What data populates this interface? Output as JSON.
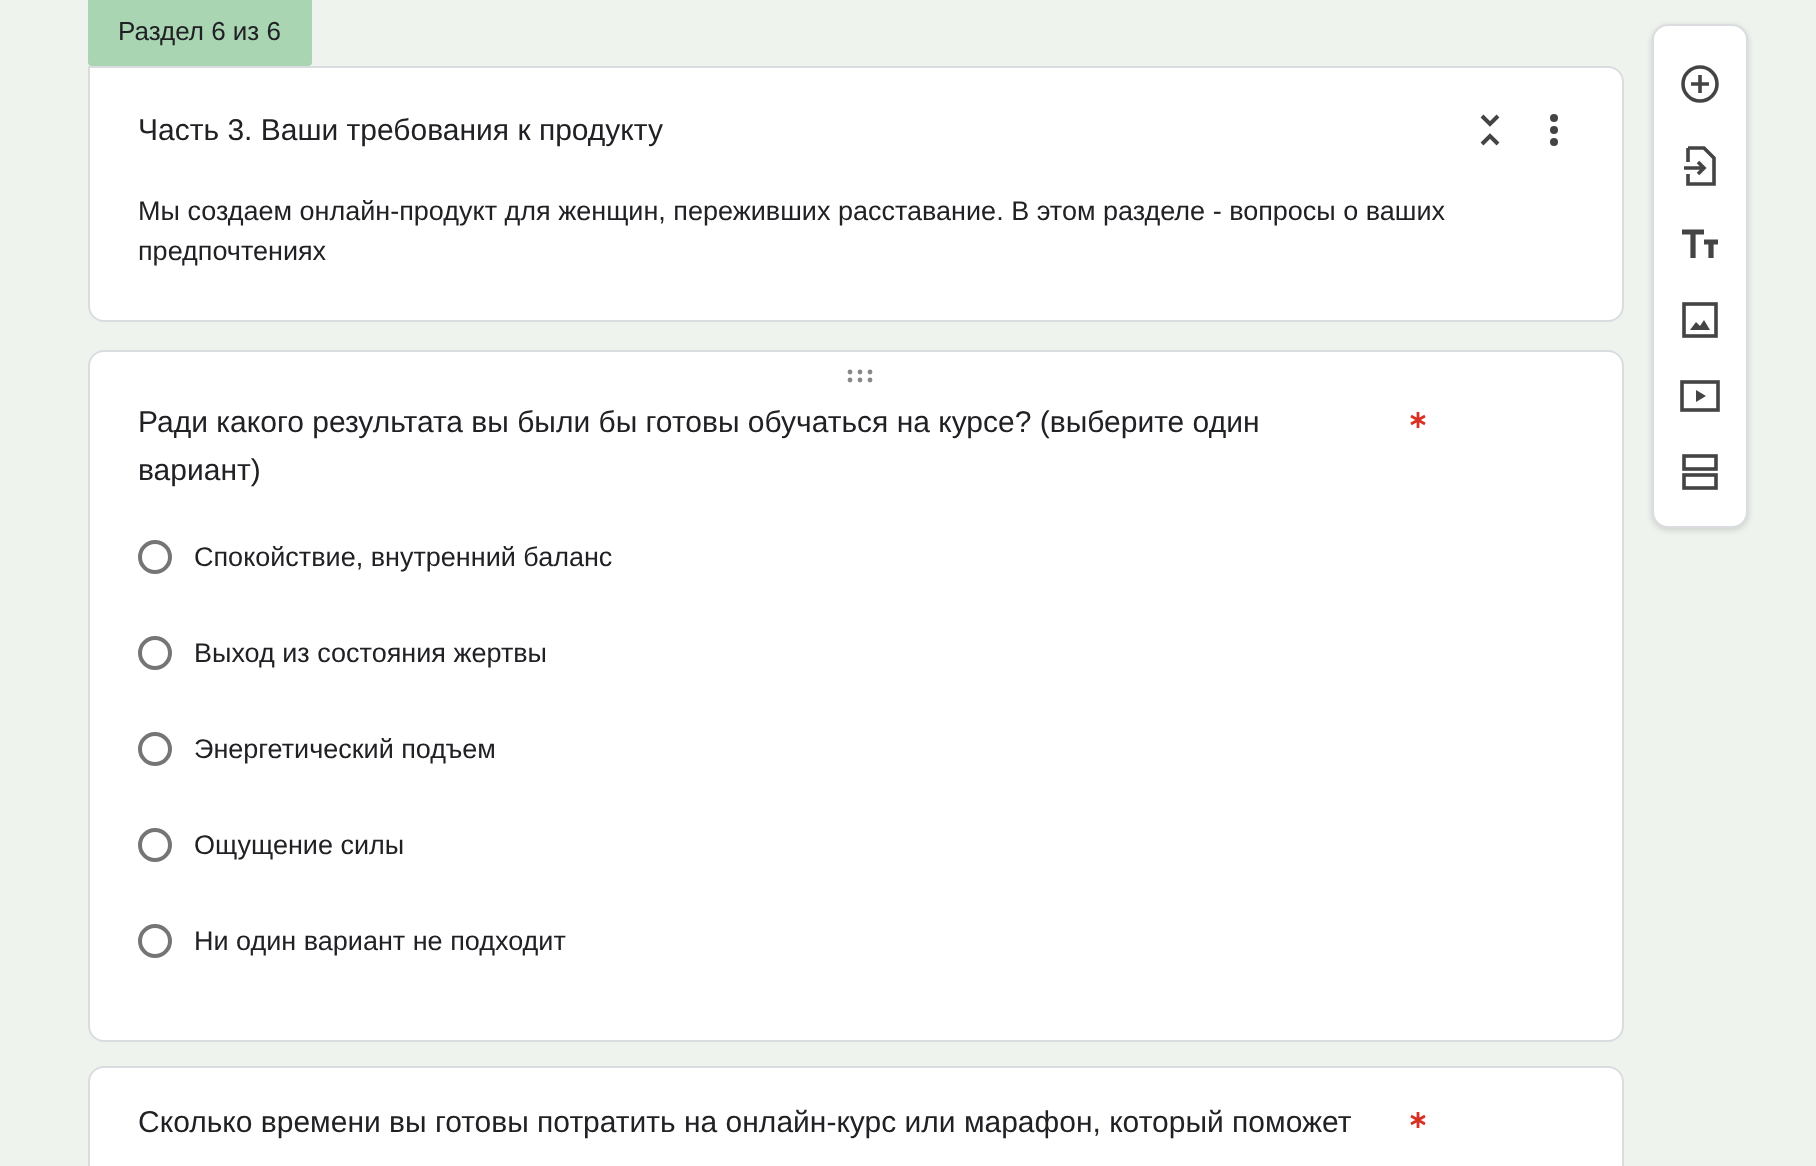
{
  "section_tab": {
    "label": "Раздел 6 из 6"
  },
  "section": {
    "title": "Часть 3. Ваши требования к продукту",
    "description": "Мы создаем онлайн-продукт для женщин, переживших расставание. В этом разделе - вопросы о ваших предпочтениях"
  },
  "questions": [
    {
      "text": "Ради какого результата вы были бы готовы обучаться на курсе? (выберите один вариант)",
      "required": true,
      "options": [
        {
          "label": "Спокойствие, внутренний баланс",
          "selected": false
        },
        {
          "label": "Выход из состояния жертвы",
          "selected": false
        },
        {
          "label": "Энергетический подъем",
          "selected": false
        },
        {
          "label": "Ощущение силы",
          "selected": false
        },
        {
          "label": "Ни один вариант не подходит",
          "selected": false
        }
      ]
    },
    {
      "text": "Сколько времени вы готовы потратить на онлайн-курс или марафон, который поможет",
      "required": true
    }
  ],
  "toolbar": [
    {
      "kind": "add"
    },
    {
      "kind": "import"
    },
    {
      "kind": "title"
    },
    {
      "kind": "image"
    },
    {
      "kind": "video"
    },
    {
      "kind": "section"
    }
  ]
}
